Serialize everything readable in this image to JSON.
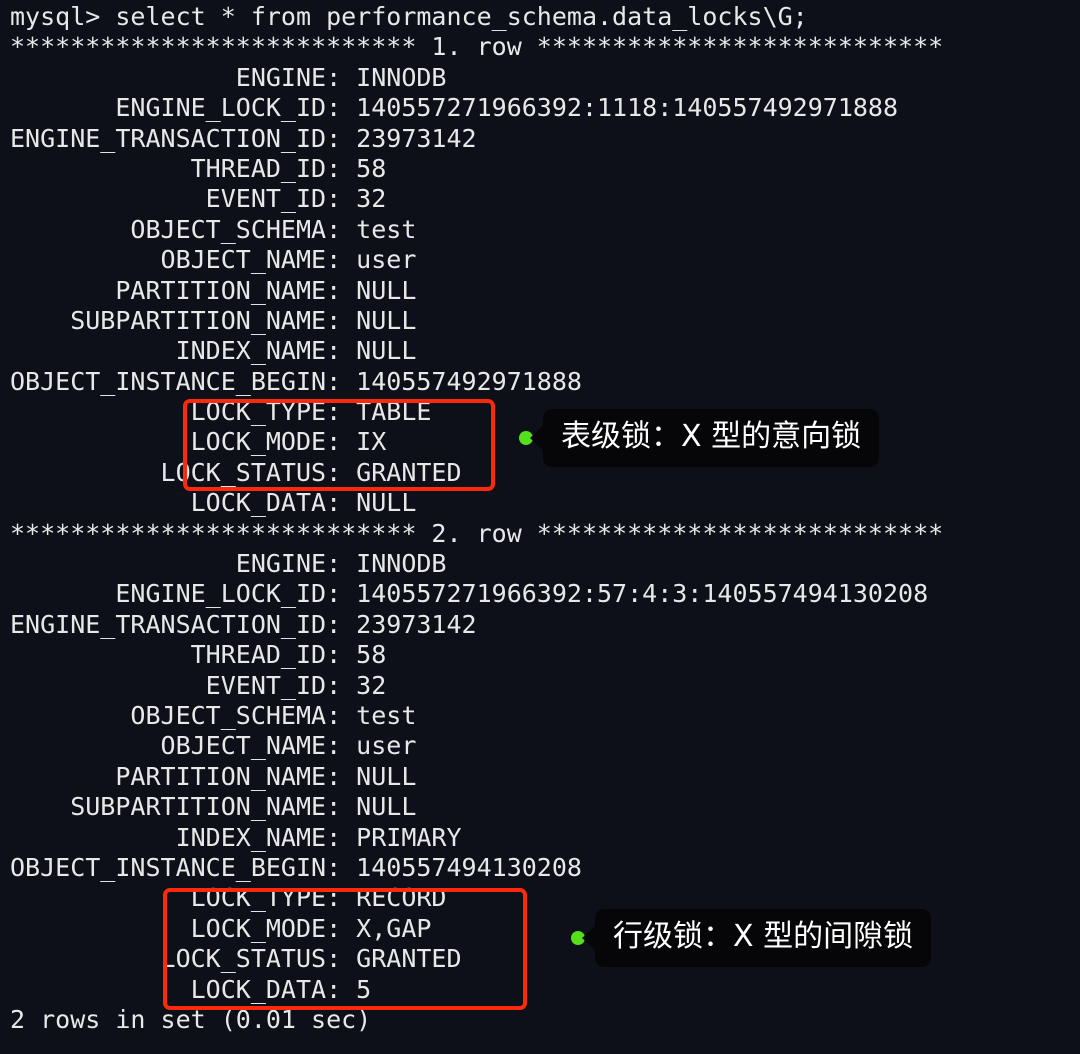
{
  "terminal": {
    "prompt_line": "mysql> select * from performance_schema.data_locks\\G;",
    "row1_separator": "*************************** 1. row ***************************",
    "row2_separator": "*************************** 2. row ***************************",
    "footer": "2 rows in set (0.01 sec)",
    "rows": [
      {
        "ENGINE": "INNODB",
        "ENGINE_LOCK_ID": "140557271966392:1118:140557492971888",
        "ENGINE_TRANSACTION_ID": "23973142",
        "THREAD_ID": "58",
        "EVENT_ID": "32",
        "OBJECT_SCHEMA": "test",
        "OBJECT_NAME": "user",
        "PARTITION_NAME": "NULL",
        "SUBPARTITION_NAME": "NULL",
        "INDEX_NAME": "NULL",
        "OBJECT_INSTANCE_BEGIN": "140557492971888",
        "LOCK_TYPE": "TABLE",
        "LOCK_MODE": "IX",
        "LOCK_STATUS": "GRANTED",
        "LOCK_DATA": "NULL"
      },
      {
        "ENGINE": "INNODB",
        "ENGINE_LOCK_ID": "140557271966392:57:4:3:140557494130208",
        "ENGINE_TRANSACTION_ID": "23973142",
        "THREAD_ID": "58",
        "EVENT_ID": "32",
        "OBJECT_SCHEMA": "test",
        "OBJECT_NAME": "user",
        "PARTITION_NAME": "NULL",
        "SUBPARTITION_NAME": "NULL",
        "INDEX_NAME": "PRIMARY",
        "OBJECT_INSTANCE_BEGIN": "140557494130208",
        "LOCK_TYPE": "RECORD",
        "LOCK_MODE": "X,GAP",
        "LOCK_STATUS": "GRANTED",
        "LOCK_DATA": "5"
      }
    ],
    "lines": [
      "mysql> select * from performance_schema.data_locks\\G;",
      "*************************** 1. row ***************************",
      "               ENGINE: INNODB",
      "       ENGINE_LOCK_ID: 140557271966392:1118:140557492971888",
      "ENGINE_TRANSACTION_ID: 23973142",
      "            THREAD_ID: 58",
      "             EVENT_ID: 32",
      "        OBJECT_SCHEMA: test",
      "          OBJECT_NAME: user",
      "       PARTITION_NAME: NULL",
      "    SUBPARTITION_NAME: NULL",
      "           INDEX_NAME: NULL",
      "OBJECT_INSTANCE_BEGIN: 140557492971888",
      "            LOCK_TYPE: TABLE",
      "            LOCK_MODE: IX",
      "          LOCK_STATUS: GRANTED",
      "            LOCK_DATA: NULL",
      "*************************** 2. row ***************************",
      "               ENGINE: INNODB",
      "       ENGINE_LOCK_ID: 140557271966392:57:4:3:140557494130208",
      "ENGINE_TRANSACTION_ID: 23973142",
      "            THREAD_ID: 58",
      "             EVENT_ID: 32",
      "        OBJECT_SCHEMA: test",
      "          OBJECT_NAME: user",
      "       PARTITION_NAME: NULL",
      "    SUBPARTITION_NAME: NULL",
      "           INDEX_NAME: PRIMARY",
      "OBJECT_INSTANCE_BEGIN: 140557494130208",
      "            LOCK_TYPE: RECORD",
      "            LOCK_MODE: X,GAP",
      "          LOCK_STATUS: GRANTED",
      "            LOCK_DATA: 5",
      "2 rows in set (0.01 sec)"
    ]
  },
  "annotations": {
    "callout_1": "表级锁：X 型的意向锁",
    "callout_2": "行级锁：X 型的间隙锁"
  },
  "colors": {
    "background": "#0d1018",
    "text": "#e8e8e8",
    "highlight_box": "#fc2a0c",
    "callout_dot": "#53e01a",
    "callout_bg": "#060608"
  }
}
